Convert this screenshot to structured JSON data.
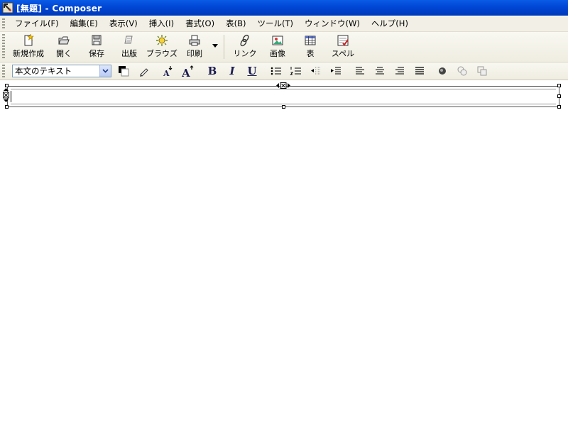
{
  "window": {
    "title": "[無題] - Composer",
    "app_icon": "composer-icon"
  },
  "menu": {
    "items": [
      {
        "label": "ファイル(F)"
      },
      {
        "label": "編集(E)"
      },
      {
        "label": "表示(V)"
      },
      {
        "label": "挿入(I)"
      },
      {
        "label": "書式(O)"
      },
      {
        "label": "表(B)"
      },
      {
        "label": "ツール(T)"
      },
      {
        "label": "ウィンドウ(W)"
      },
      {
        "label": "ヘルプ(H)"
      }
    ]
  },
  "toolbar": {
    "new_label": "新規作成",
    "open_label": "開く",
    "save_label": "保存",
    "publish_label": "出版",
    "browse_label": "ブラウズ",
    "print_label": "印刷",
    "link_label": "リンク",
    "image_label": "画像",
    "table_label": "表",
    "spell_label": "スペル"
  },
  "format": {
    "paragraph_style": "本文のテキスト",
    "text_color": "#000000",
    "bold": "B",
    "italic": "I",
    "underline": "U"
  },
  "editor": {
    "content": ""
  }
}
